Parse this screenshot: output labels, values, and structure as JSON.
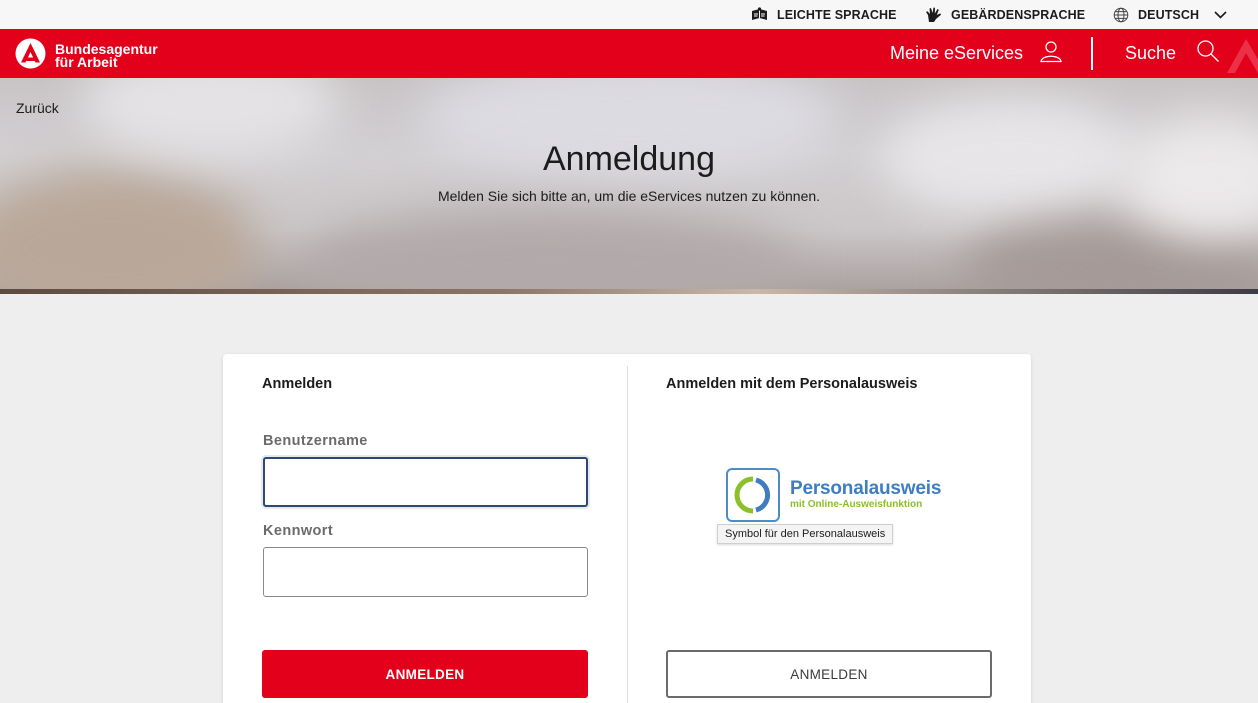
{
  "utility_bar": {
    "easy_language": "LEICHTE SPRACHE",
    "sign_language": "GEBÄRDENSPRACHE",
    "language": "DEUTSCH"
  },
  "header": {
    "logo_line1": "Bundesagentur",
    "logo_line2": "für Arbeit",
    "my_eservices": "Meine eServices",
    "search": "Suche",
    "brand_color": "#e3001b"
  },
  "hero": {
    "back": "Zurück",
    "title": "Anmeldung",
    "subtitle": "Melden Sie sich bitte an, um die eServices nutzen zu können."
  },
  "login": {
    "title": "Anmelden",
    "username_label": "Benutzername",
    "username_value": "",
    "password_label": "Kennwort",
    "password_value": "",
    "submit": "ANMELDEN"
  },
  "eid_login": {
    "title": "Anmelden mit dem Personalausweis",
    "logo_main": "Personalausweis",
    "logo_sub": "mit Online-Ausweisfunktion",
    "tooltip": "Symbol für den Personalausweis",
    "submit": "ANMELDEN"
  },
  "icons": {
    "easy_language": "easy-language-icon",
    "sign_language": "sign-language-hand-icon",
    "language": "globe-icon",
    "language_dropdown": "chevron-down-icon",
    "user": "user-icon",
    "search": "search-icon",
    "logo": "ba-logo-icon"
  }
}
